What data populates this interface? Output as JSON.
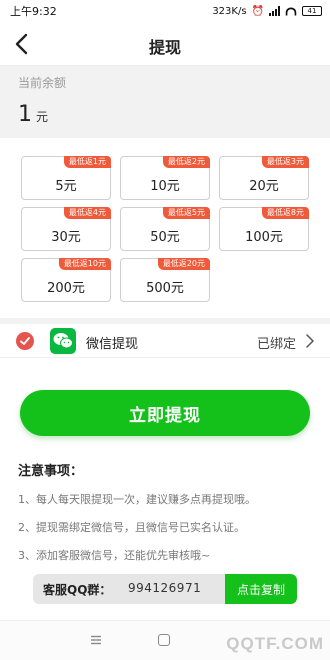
{
  "status_bar": {
    "time": "上午9:32",
    "network_speed": "323K/s",
    "battery": "41"
  },
  "header": {
    "title": "提现",
    "back_icon": "back-arrow-icon"
  },
  "balance": {
    "label": "当前余额",
    "value": "1",
    "unit": "元"
  },
  "amounts": [
    {
      "badge": "最低返1元",
      "label": "5元"
    },
    {
      "badge": "最低返2元",
      "label": "10元"
    },
    {
      "badge": "最低返3元",
      "label": "20元"
    },
    {
      "badge": "最低返4元",
      "label": "30元"
    },
    {
      "badge": "最低返5元",
      "label": "50元"
    },
    {
      "badge": "最低返8元",
      "label": "100元"
    },
    {
      "badge": "最低返10元",
      "label": "200元"
    },
    {
      "badge": "最低返20元",
      "label": "500元"
    }
  ],
  "method": {
    "label": "微信提现",
    "status": "已绑定",
    "icon": "wechat-icon"
  },
  "action": {
    "withdraw_label": "立即提现"
  },
  "notes": {
    "title": "注意事项：",
    "items": [
      "1、每人每天限提现一次，建议赚多点再提现哦。",
      "2、提现需绑定微信号，且微信号已实名认证。",
      "3、添加客服微信号，还能优先审核哦~"
    ]
  },
  "service": {
    "label": "客服QQ群：",
    "number": "994126971",
    "copy_label": "点击复制"
  },
  "watermark": "QQTF.COM",
  "colors": {
    "accent_green": "#14c11a",
    "badge_red": "#ef5a3a",
    "check_red": "#e4554f",
    "wechat_green": "#09b83e"
  }
}
